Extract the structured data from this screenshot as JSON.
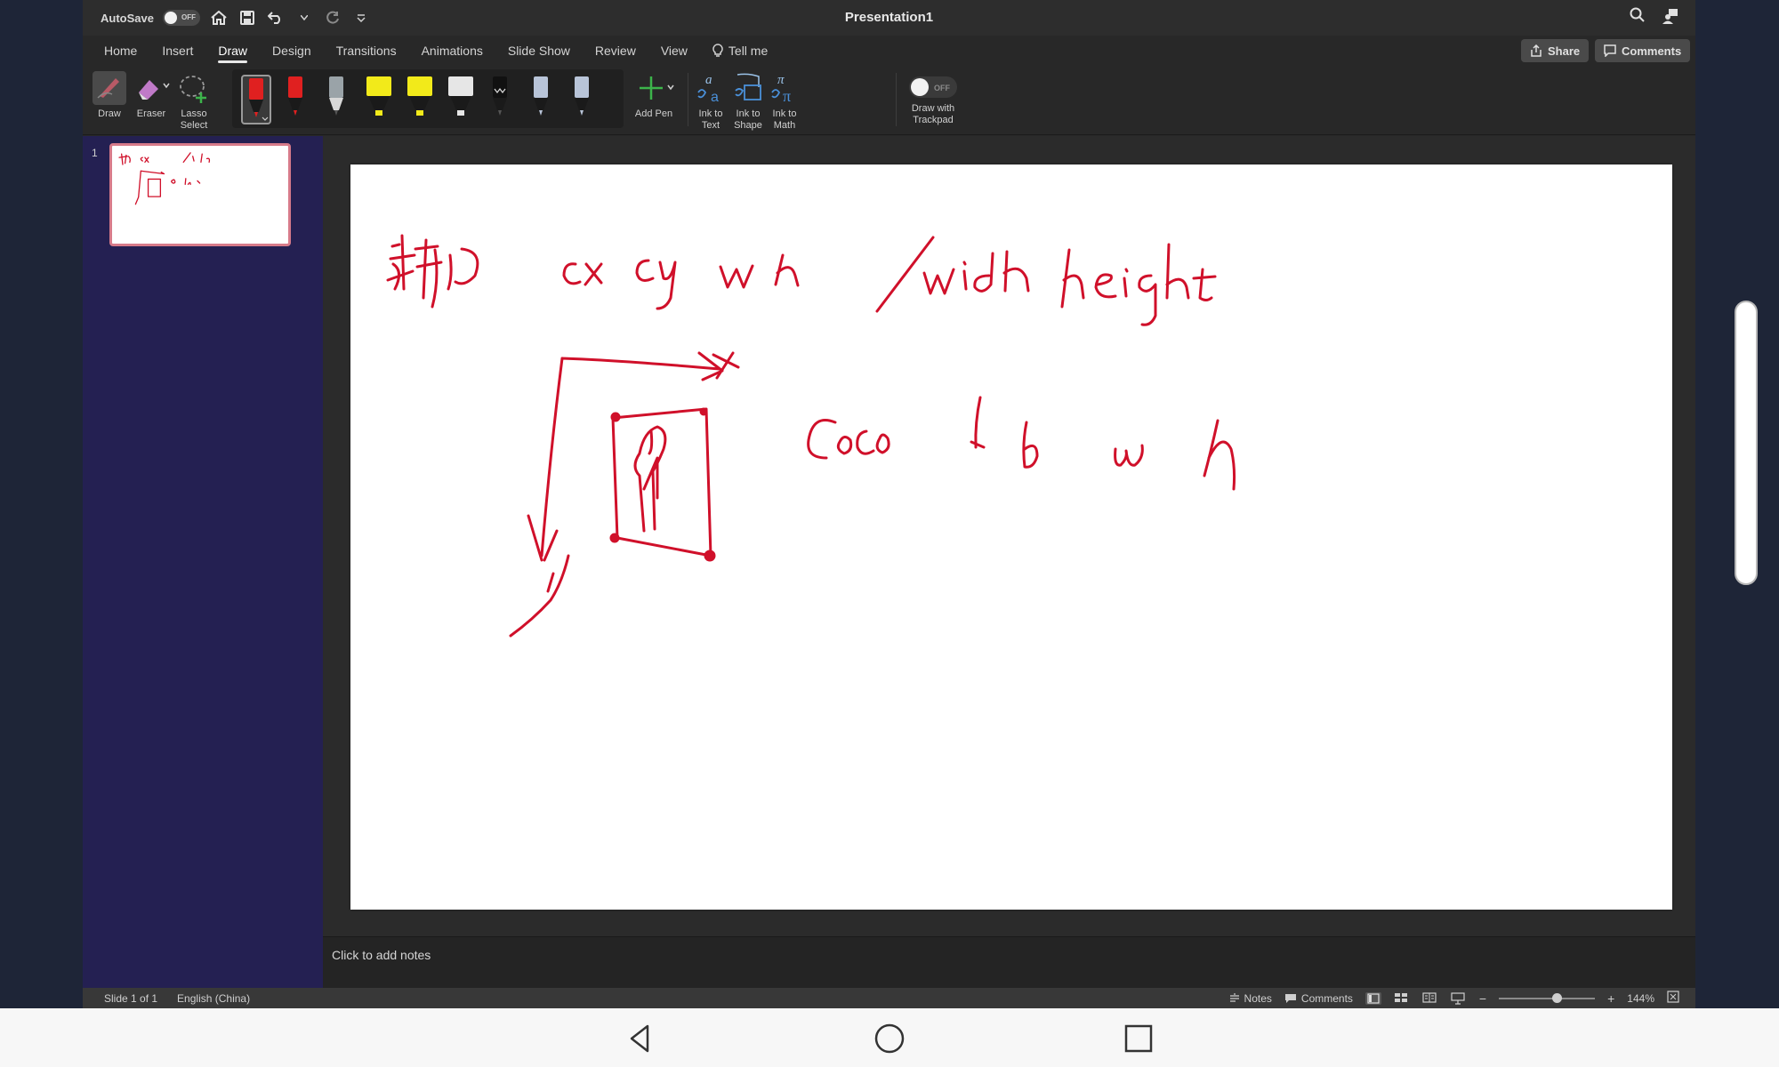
{
  "window": {
    "title": "Presentation1"
  },
  "quick_access": {
    "autosave_label": "AutoSave",
    "autosave_state": "OFF"
  },
  "tabs": [
    {
      "label": "Home"
    },
    {
      "label": "Insert"
    },
    {
      "label": "Draw",
      "active": true
    },
    {
      "label": "Design"
    },
    {
      "label": "Transitions"
    },
    {
      "label": "Animations"
    },
    {
      "label": "Slide Show"
    },
    {
      "label": "Review"
    },
    {
      "label": "View"
    },
    {
      "label": "Tell me"
    }
  ],
  "header_buttons": {
    "share": "Share",
    "comments": "Comments"
  },
  "ribbon": {
    "draw_label": "Draw",
    "eraser_label": "Eraser",
    "lasso_label_1": "Lasso",
    "lasso_label_2": "Select",
    "pens": [
      {
        "color": "#e02020",
        "type": "pen",
        "selected": true
      },
      {
        "color": "#e02020",
        "type": "pen"
      },
      {
        "color": "#9aa3a8",
        "type": "pencil"
      },
      {
        "color": "#f2ea1a",
        "type": "highlighter"
      },
      {
        "color": "#f2ea1a",
        "type": "highlighter"
      },
      {
        "color": "#e6e6e6",
        "type": "highlighter"
      },
      {
        "color": "#111111",
        "type": "pen"
      },
      {
        "color": "#b8c4d8",
        "type": "pen"
      },
      {
        "color": "#b8c4d8",
        "type": "pen"
      }
    ],
    "add_pen_label": "Add Pen",
    "ink_to_text_1": "Ink to",
    "ink_to_text_2": "Text",
    "ink_to_shape_1": "Ink to",
    "ink_to_shape_2": "Shape",
    "ink_to_math_1": "Ink to",
    "ink_to_math_2": "Math",
    "draw_trackpad_1": "Draw with",
    "draw_trackpad_2": "Trackpad",
    "draw_trackpad_state": "OFF"
  },
  "thumbnails": [
    {
      "number": "1"
    }
  ],
  "notes_placeholder": "Click to add notes",
  "status": {
    "slide": "Slide 1 of 1",
    "language": "English (China)",
    "notes": "Notes",
    "comments": "Comments",
    "zoom": "144%"
  },
  "colors": {
    "ink": "#d0102a",
    "thumb_border": "#d77b8a",
    "pane_bg": "#242052"
  }
}
